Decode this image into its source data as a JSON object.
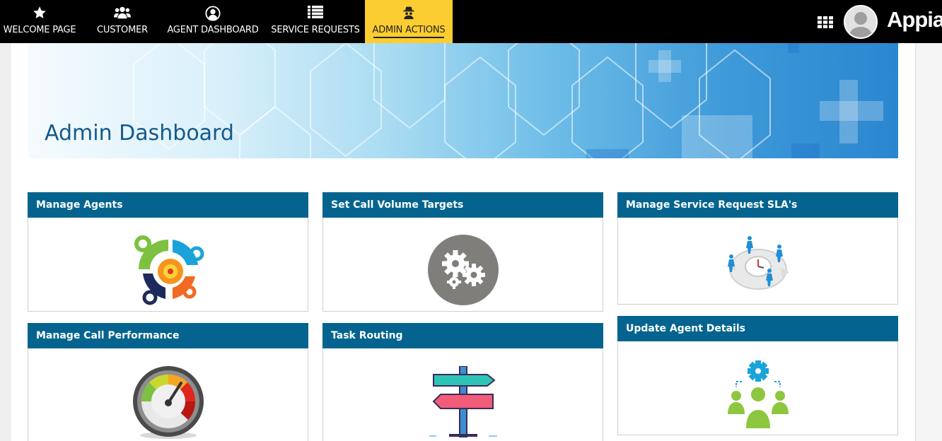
{
  "nav": {
    "items": [
      {
        "label": "WELCOME PAGE",
        "icon": "star-icon"
      },
      {
        "label": "CUSTOMER",
        "icon": "users-icon"
      },
      {
        "label": "AGENT DASHBOARD",
        "icon": "user-circle-icon"
      },
      {
        "label": "SERVICE REQUESTS",
        "icon": "list-icon"
      },
      {
        "label": "ADMIN ACTIONS",
        "icon": "admin-spy-icon",
        "active": true
      }
    ],
    "apps_icon": "grid-icon",
    "brand": "Appian"
  },
  "banner": {
    "title": "Admin Dashboard"
  },
  "cards": [
    {
      "title": "Manage Agents",
      "image": "manage-agents-illustration"
    },
    {
      "title": "Set Call Volume Targets",
      "image": "gears-illustration"
    },
    {
      "title": "Manage Service Request SLA's",
      "image": "sla-clock-illustration"
    },
    {
      "title": "Manage Call Performance",
      "image": "speedometer-illustration"
    },
    {
      "title": "Task Routing",
      "image": "signpost-illustration"
    },
    {
      "title": "Update Agent Details",
      "image": "team-gear-illustration"
    }
  ],
  "colors": {
    "nav_bg": "#000000",
    "nav_active": "#fccd30",
    "card_header": "#04648f",
    "banner_title": "#145a8c"
  }
}
